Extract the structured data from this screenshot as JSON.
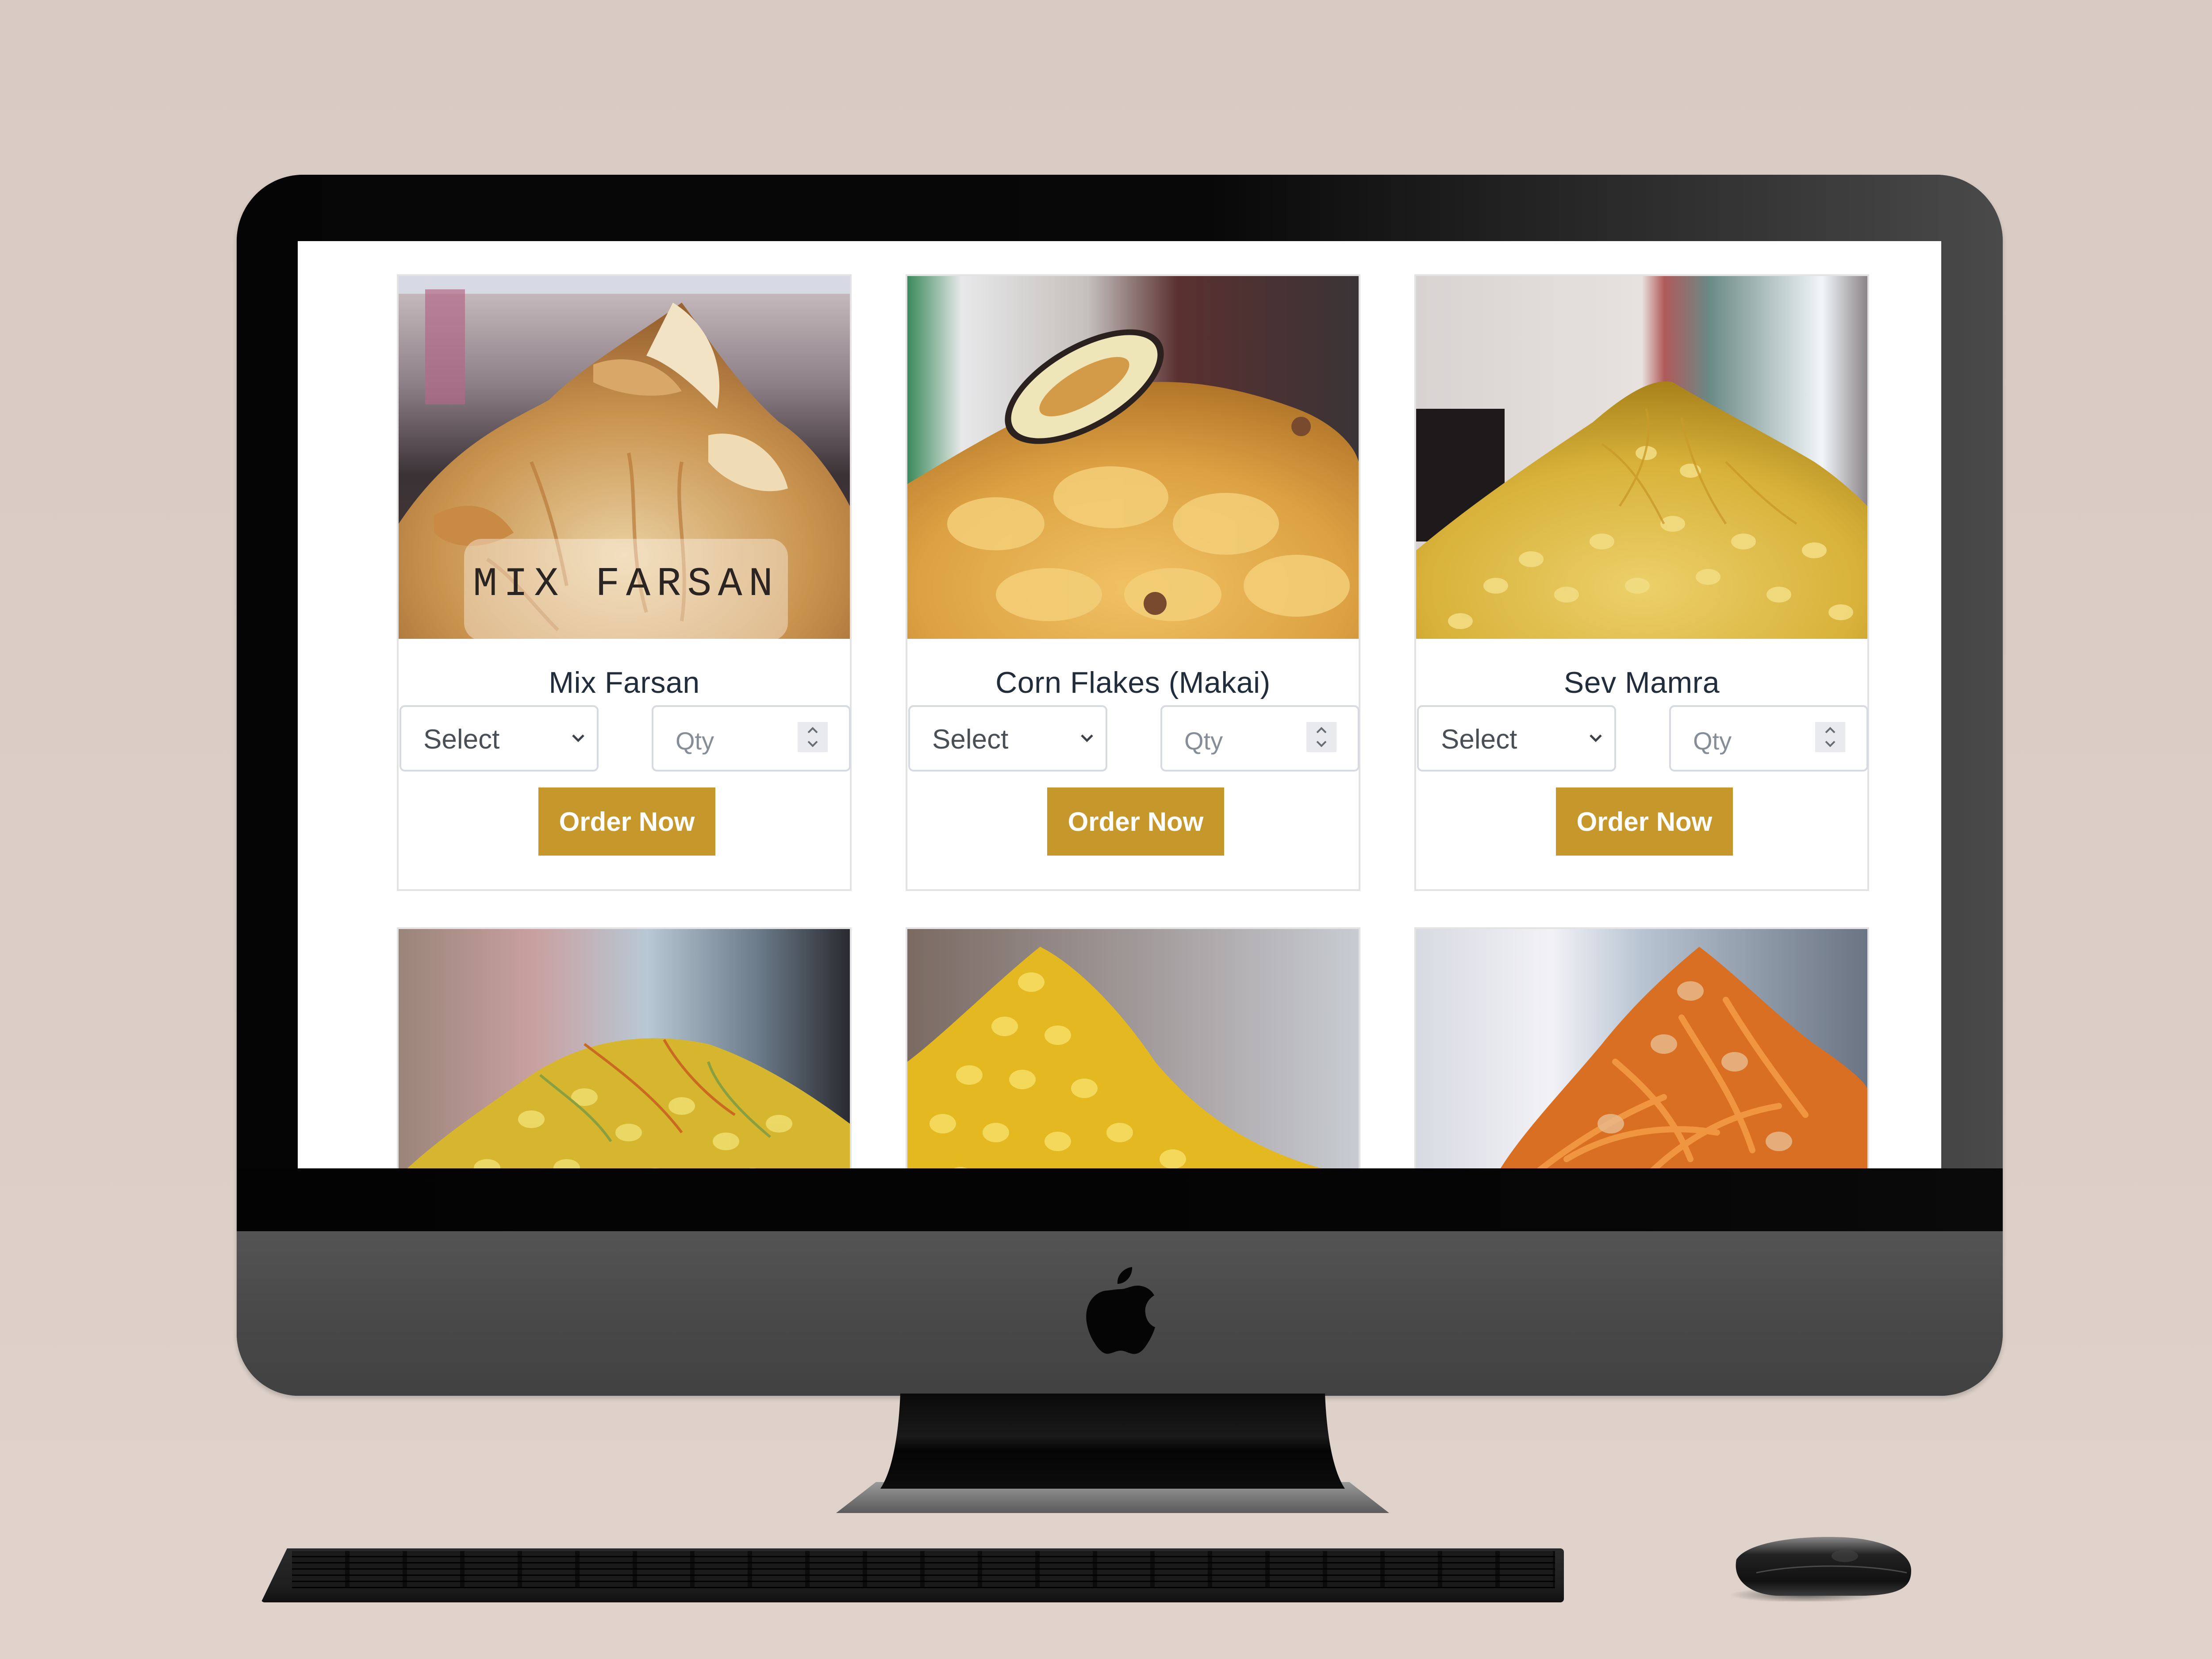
{
  "scene": {
    "device": "iMac-style monitor mockup",
    "background_color": "#d8cbc4",
    "accent_color": "#c6972a"
  },
  "products": [
    {
      "title": "Mix Farsan",
      "image_caption": "MIX FARSAN",
      "image_alt": "mix farsan snack photo",
      "select_value": "Select",
      "qty_placeholder": "Qty",
      "button_label": "Order Now",
      "palette": [
        "#c28a3e",
        "#e3c48c",
        "#8a5a2c"
      ]
    },
    {
      "title": "Corn Flakes (Makai)",
      "image_caption": "",
      "image_alt": "corn flakes chivda photo",
      "select_value": "Select",
      "qty_placeholder": "Qty",
      "button_label": "Order Now",
      "palette": [
        "#d9a441",
        "#f0c766",
        "#a87028"
      ]
    },
    {
      "title": "Sev Mamra",
      "image_caption": "",
      "image_alt": "sev mamra photo",
      "select_value": "Select",
      "qty_placeholder": "Qty",
      "button_label": "Order Now",
      "palette": [
        "#d8b23a",
        "#ecd066",
        "#b08a1c"
      ]
    }
  ],
  "products_row2": [
    {
      "image_alt": "mixed namkeen photo",
      "palette": [
        "#d4b02a",
        "#e9cf4a",
        "#c07a26"
      ]
    },
    {
      "image_alt": "yellow mamra photo",
      "palette": [
        "#e3b820",
        "#f2d448",
        "#c49a14"
      ]
    },
    {
      "image_alt": "orange sev mix photo",
      "palette": [
        "#d86f22",
        "#ee9a3c",
        "#b85515"
      ]
    }
  ],
  "icons": {
    "select_chevron": "chevron-down",
    "qty_spinner": "up-down-arrows",
    "brand_logo": "apple-logo"
  }
}
